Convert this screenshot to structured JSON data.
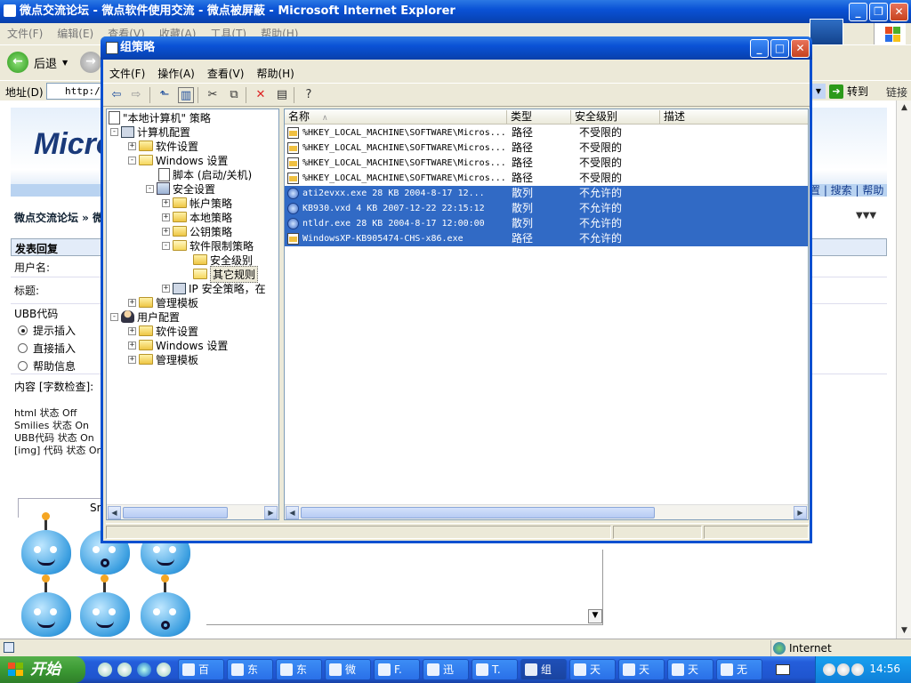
{
  "ie": {
    "title": "微点交流论坛 - 微点软件使用交流 - 微点被屏蔽 - Microsoft Internet Explorer",
    "menu": [
      "文件(F)",
      "编辑(E)",
      "查看(V)",
      "收藏(A)",
      "工具(T)",
      "帮助(H)"
    ],
    "back_label": "后退",
    "address_label": "地址(D)",
    "address_value": "http://",
    "go_label": "转到",
    "links_label": "链接",
    "logo_text": "Micro",
    "nav_links": "置 | 搜索 | 帮助",
    "breadcrumb": "微点交流论坛 » 微",
    "dots": "▼▼▼",
    "reply_header": "发表回复",
    "username_label": "用户名:",
    "subject_label": "标题:",
    "ubb_label": "UBB代码",
    "ubb_options": [
      "提示插入",
      "直接插入",
      "帮助信息"
    ],
    "content_label": "内容 [字数检查]:",
    "status_lines": [
      "html 状态 Off",
      "Smilies 状态 On",
      "UBB代码 状态 On",
      "[img] 代码 状态 On"
    ],
    "smile_tab": "Sm",
    "zone": "Internet"
  },
  "gp": {
    "title": "组策略",
    "menu": [
      "文件(F)",
      "操作(A)",
      "查看(V)",
      "帮助(H)"
    ],
    "tree": {
      "root": "\"本地计算机\" 策略",
      "computer_config": "计算机配置",
      "software_settings": "软件设置",
      "windows_settings": "Windows 设置",
      "scripts": "脚本 (启动/关机)",
      "security_settings": "安全设置",
      "account_policy": "帐户策略",
      "local_policy": "本地策略",
      "public_key_policy": "公钥策略",
      "software_restriction": "软件限制策略",
      "security_levels": "安全级别",
      "other_rules": "其它规则",
      "ip_security": "IP 安全策略，在",
      "admin_templates": "管理模板",
      "user_config": "用户配置",
      "user_software_settings": "软件设置",
      "user_windows_settings": "Windows 设置",
      "user_admin_templates": "管理模板"
    },
    "columns": [
      "名称",
      "类型",
      "安全级别",
      "描述"
    ],
    "rows": [
      {
        "name": "%HKEY_LOCAL_MACHINE\\SOFTWARE\\Micros...",
        "type": "路径",
        "level": "不受限的"
      },
      {
        "name": "%HKEY_LOCAL_MACHINE\\SOFTWARE\\Micros...",
        "type": "路径",
        "level": "不受限的"
      },
      {
        "name": "%HKEY_LOCAL_MACHINE\\SOFTWARE\\Micros...",
        "type": "路径",
        "level": "不受限的"
      },
      {
        "name": "%HKEY_LOCAL_MACHINE\\SOFTWARE\\Micros...",
        "type": "路径",
        "level": "不受限的"
      },
      {
        "name": "ati2evxx.exe  28  KB  2004-8-17  12...",
        "type": "散列",
        "level": "不允许的"
      },
      {
        "name": "KB930.vxd  4  KB  2007-12-22  22:15:12",
        "type": "散列",
        "level": "不允许的"
      },
      {
        "name": "ntldr.exe  28  KB  2004-8-17  12:00:00",
        "type": "散列",
        "level": "不允许的"
      },
      {
        "name": "WindowsXP-KB905474-CHS-x86.exe",
        "type": "路径",
        "level": "不允许的"
      }
    ]
  },
  "taskbar": {
    "start": "开始",
    "tasks": [
      "百",
      "东",
      "东",
      "微",
      "F.",
      "迅",
      "T.",
      "组",
      "天",
      "天",
      "天",
      "无"
    ],
    "clock": "14:56"
  }
}
